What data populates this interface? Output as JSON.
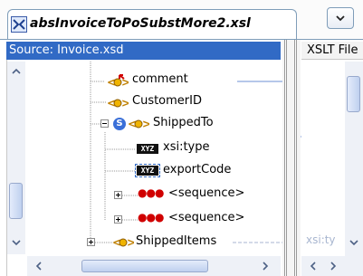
{
  "editor_tab": {
    "title": "absInvoiceToPoSubstMore2.xsl",
    "icon": "xsl-mapper-icon"
  },
  "source_panel": {
    "title": "Source: Invoice.xsd",
    "tree": [
      {
        "label": "comment",
        "icon": "element-icon-optional",
        "mapped": true
      },
      {
        "label": "CustomerID",
        "icon": "element-icon"
      },
      {
        "label": "ShippedTo",
        "icon": "element-icon",
        "expanded": true,
        "badge": "S"
      },
      {
        "label": "xsi:type",
        "icon": "xyz-attribute-icon",
        "badge_text": "XYZ"
      },
      {
        "label": "exportCode",
        "icon": "xyz-attribute-icon",
        "badge_text": "XYZ",
        "selected": true
      },
      {
        "label": "<sequence>",
        "icon": "sequence-icon",
        "expanded": false
      },
      {
        "label": "<sequence>",
        "icon": "sequence-icon",
        "expanded": false
      },
      {
        "label": "ShippedItems",
        "icon": "element-icon",
        "expanded": false,
        "mapped": true
      }
    ]
  },
  "xslt_panel": {
    "title": "XSLT File",
    "visible_item": "xsi:ty"
  },
  "colors": {
    "selection_blue": "#316ac5",
    "mapping_line": "#6d8fd6",
    "sequence_red": "#d00000"
  }
}
